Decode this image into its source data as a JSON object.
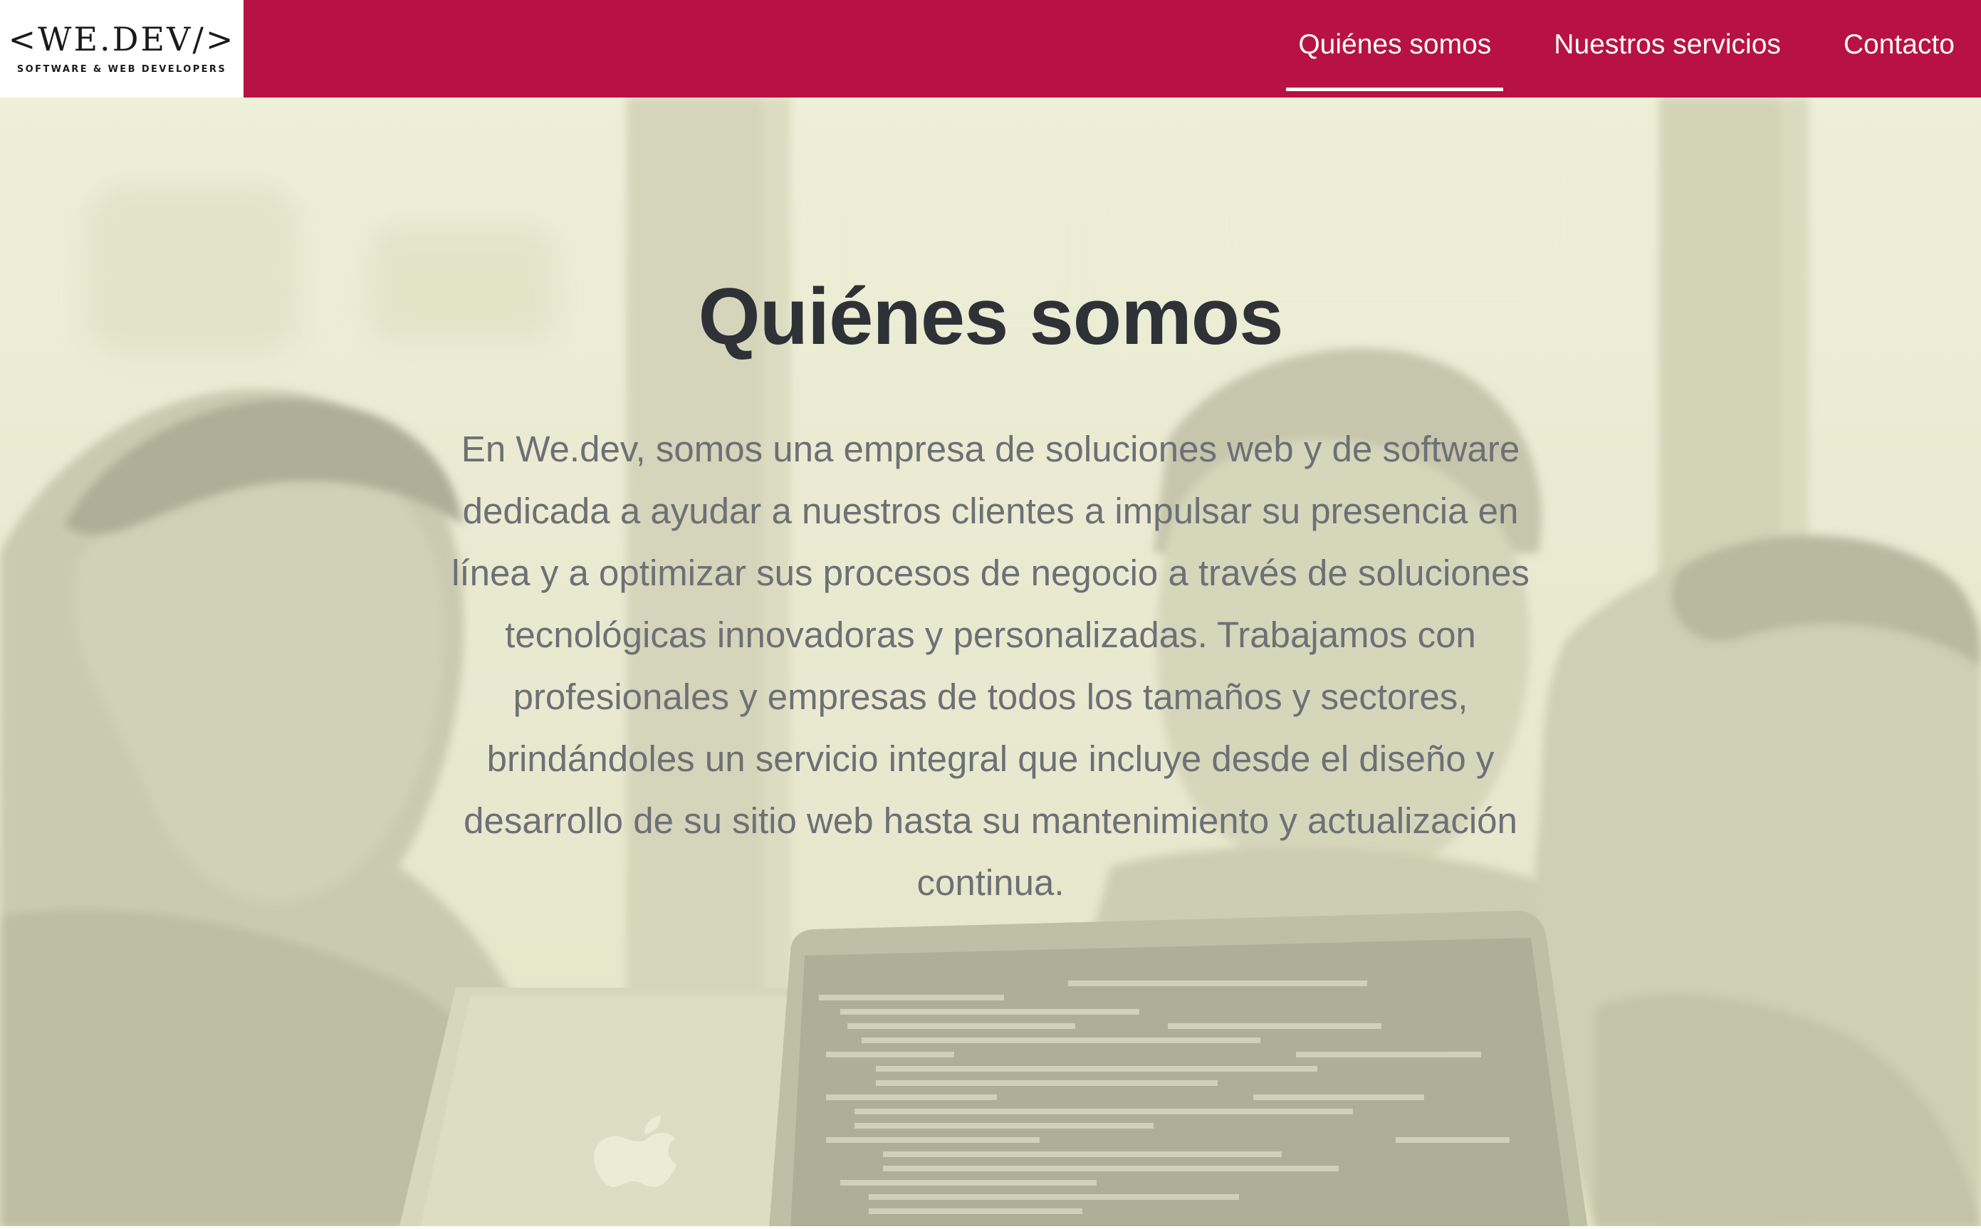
{
  "brand": {
    "logo_text": "<WE.DEV/>",
    "logo_tagline": "SOFTWARE & WEB DEVELOPERS"
  },
  "nav": {
    "items": [
      {
        "label": "Quiénes somos",
        "active": true
      },
      {
        "label": "Nuestros servicios",
        "active": false
      },
      {
        "label": "Contacto",
        "active": false
      }
    ]
  },
  "hero": {
    "title": "Quiénes somos",
    "body": "En We.dev, somos una empresa de soluciones web y de software dedicada a ayudar a nuestros clientes a impulsar su presencia en línea y a optimizar sus procesos de negocio a través de soluciones tecnológicas innovadoras y personalizadas. Trabajamos con profesionales y empresas de todos los tamaños y sectores, brindándoles un servicio integral que incluye desde el diseño y desarrollo de su sitio web hasta su mantenimiento y actualización continua."
  },
  "colors": {
    "header_bg": "#b81146",
    "hero_tint": "#e6e7cf",
    "title": "#2e3136",
    "body_text": "#6d7075"
  }
}
